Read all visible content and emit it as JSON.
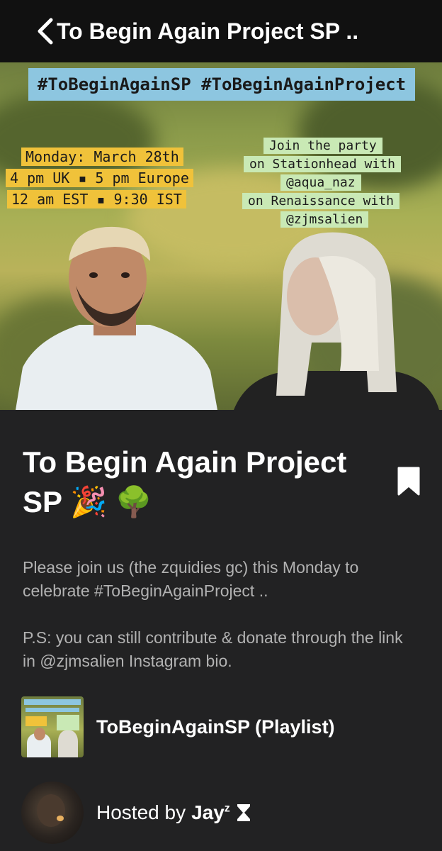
{
  "header": {
    "back_icon": "chevron-left-icon",
    "title": "To Begin Again Project SP .."
  },
  "cover": {
    "hashtags": "#ToBeginAgainSP #ToBeginAgainProject",
    "schedule": [
      "Monday: March 28th",
      "4 pm UK ▪ 5 pm Europe",
      "12 am EST ▪ 9:30 IST"
    ],
    "party": [
      "Join the party",
      "on Stationhead with",
      "@aqua_naz",
      "on Renaissance with",
      "@zjmsalien"
    ]
  },
  "event": {
    "title": "To Begin Again Project SP 🎉 🌳",
    "bookmark_icon": "bookmark-icon",
    "description": [
      "Please join us (the zquidies gc) this Monday to celebrate #ToBeginAgainProject ..",
      "P.S: you can still contribute & donate through the link in @zjmsalien Instagram bio."
    ]
  },
  "playlist": {
    "label": "ToBeginAgainSP (Playlist)"
  },
  "host": {
    "prefix": "Hosted by",
    "name": "Jay",
    "name_sup": "z",
    "badge_icon": "hourglass-icon"
  },
  "colors": {
    "background": "#222223",
    "topbar": "#111111",
    "description_text": "#b2b2b2",
    "hashtag_bg": "#8dc6e0",
    "schedule_bg": "#f0c23a",
    "party_bg": "#c9e9b5"
  }
}
